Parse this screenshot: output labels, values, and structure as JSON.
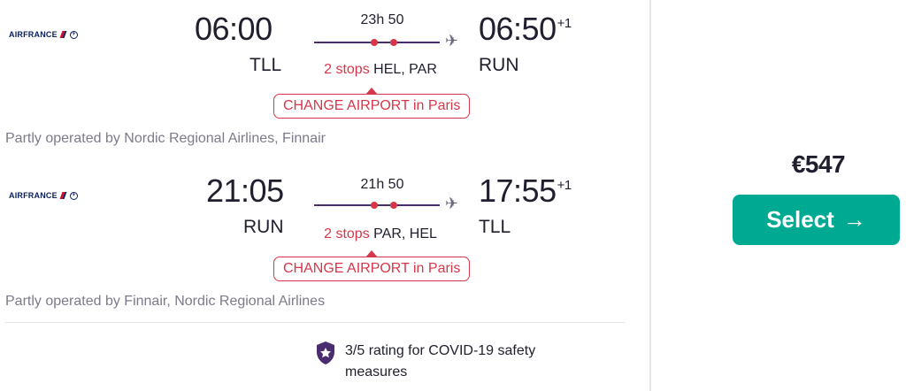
{
  "outbound": {
    "airline_logo": "AIRFRANCE",
    "depart_time": "06:00",
    "arrive_time": "06:50",
    "arrive_day_offset": "+1",
    "from": "TLL",
    "to": "RUN",
    "duration": "23h 50",
    "stops_count": "2 stops",
    "stops_airports": "HEL, PAR",
    "change_airport": "CHANGE AIRPORT in Paris",
    "operated_by": "Partly operated by Nordic Regional Airlines, Finnair"
  },
  "return": {
    "airline_logo": "AIRFRANCE",
    "depart_time": "21:05",
    "arrive_time": "17:55",
    "arrive_day_offset": "+1",
    "from": "RUN",
    "to": "TLL",
    "duration": "21h 50",
    "stops_count": "2 stops",
    "stops_airports": "PAR, HEL",
    "change_airport": "CHANGE AIRPORT in Paris",
    "operated_by": "Partly operated by Finnair, Nordic Regional Airlines"
  },
  "covid_rating": "3/5 rating for COVID-19 safety measures",
  "price": "€547",
  "select_label": "Select",
  "colors": {
    "accent_green": "#00a991",
    "warning_red": "#d7364a",
    "route_purple": "#4a2d6e",
    "shield_purple": "#4a2d6e"
  },
  "icons": [
    "airplane-icon",
    "stop-dot-icon",
    "shield-icon",
    "arrow-right-icon"
  ]
}
